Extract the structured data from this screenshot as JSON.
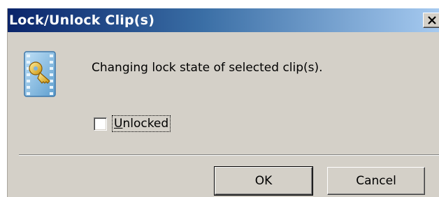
{
  "window": {
    "title": "Lock/Unlock Clip(s)"
  },
  "icons": {
    "app": "clip-lock-key-icon",
    "close": "close-icon"
  },
  "colors": {
    "titlebar_start": "#0a246a",
    "titlebar_end": "#a6caf0",
    "dialog_face": "#d4d0c8"
  },
  "content": {
    "message": "Changing lock state of selected clip(s)."
  },
  "checkbox": {
    "accel": "U",
    "rest": "nlocked",
    "checked": false
  },
  "buttons": {
    "ok": "OK",
    "cancel": "Cancel"
  }
}
